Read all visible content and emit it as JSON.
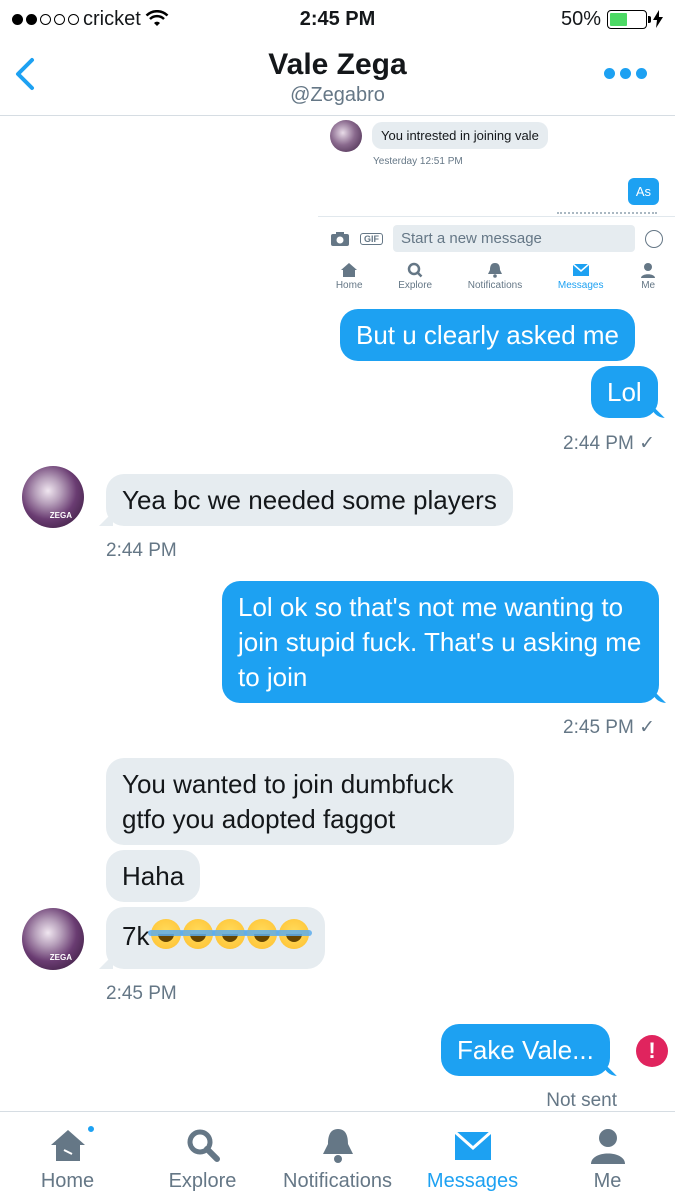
{
  "status_bar": {
    "carrier": "cricket",
    "time": "2:45 PM",
    "battery": "50%",
    "battery_level": 0.5
  },
  "header": {
    "name": "Vale Zega",
    "handle": "@Zegabro"
  },
  "embedded_screenshot": {
    "incoming_text": "You intrested in joining vale",
    "incoming_time": "Yesterday 12:51 PM",
    "outgoing_text": "As",
    "composer_placeholder": "Start a new message",
    "gif_label": "GIF",
    "tabs": [
      "Home",
      "Explore",
      "Notifications",
      "Messages",
      "Me"
    ]
  },
  "messages": [
    {
      "id": "m1",
      "dir": "out",
      "text": "But u clearly asked me"
    },
    {
      "id": "m2",
      "dir": "out",
      "text": "Lol"
    },
    {
      "id": "t1",
      "time": "2:44 PM ✓"
    },
    {
      "id": "m3",
      "dir": "in",
      "text": "Yea bc we needed some players"
    },
    {
      "id": "t2",
      "time": "2:44 PM"
    },
    {
      "id": "m4",
      "dir": "out",
      "text": "Lol ok so that's not me wanting to join stupid fuck. That's u asking me to join"
    },
    {
      "id": "t3",
      "time": "2:45 PM ✓"
    },
    {
      "id": "m5",
      "dir": "in",
      "text": "You wanted to join dumbfuck gtfo you adopted faggot"
    },
    {
      "id": "m6",
      "dir": "in",
      "text": "Haha"
    },
    {
      "id": "m7",
      "dir": "in",
      "text": "7k"
    },
    {
      "id": "t4",
      "time": "2:45 PM"
    },
    {
      "id": "m8",
      "dir": "out",
      "text": "Fake Vale..."
    },
    {
      "id": "t5",
      "time": "Not sent"
    }
  ],
  "avatar_tag": "ZEGA",
  "error_icon_glyph": "!",
  "tabbar": {
    "home": "Home",
    "explore": "Explore",
    "notifications": "Notifications",
    "messages": "Messages",
    "me": "Me",
    "active": "Messages"
  },
  "colors": {
    "accent": "#1da1f2",
    "incoming_bubble": "#e6ecf0",
    "error": "#e0245e",
    "battery": "#4cd964"
  }
}
